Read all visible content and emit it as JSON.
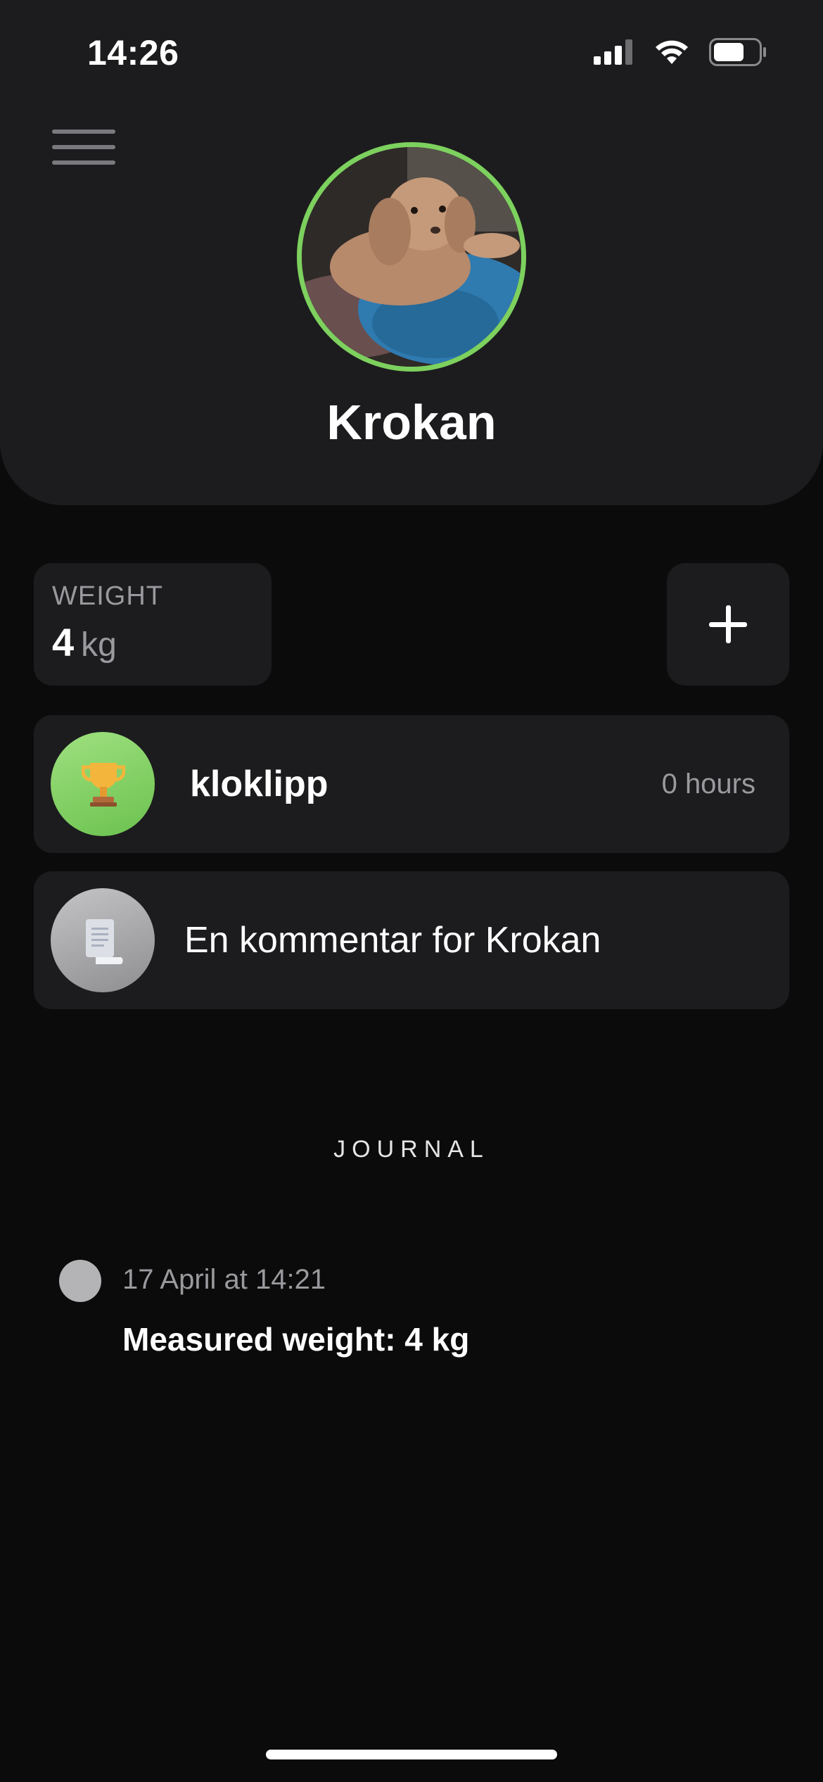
{
  "status_bar": {
    "time": "14:26",
    "icons": [
      "cellular-signal-icon",
      "wifi-icon",
      "battery-icon"
    ]
  },
  "header": {
    "menu_icon": "hamburger-menu-icon",
    "pet_name": "Krokan",
    "avatar_ring_color": "#7dd15e"
  },
  "weight": {
    "label": "WEIGHT",
    "value": "4",
    "unit": "kg"
  },
  "add_button": {
    "icon": "plus-icon"
  },
  "cards": {
    "trophy": {
      "icon": "trophy-icon",
      "title": "kloklipp",
      "meta": "0 hours"
    },
    "comment": {
      "icon": "document-icon",
      "title": "En kommentar for Krokan"
    }
  },
  "journal": {
    "heading": "JOURNAL",
    "entries": [
      {
        "time": "17 April at 14:21",
        "text": "Measured weight: 4 kg"
      }
    ]
  },
  "colors": {
    "background": "#0b0b0b",
    "card": "#1c1c1e",
    "accent_green": "#7dd15e",
    "secondary_text": "#9a9a9e"
  }
}
